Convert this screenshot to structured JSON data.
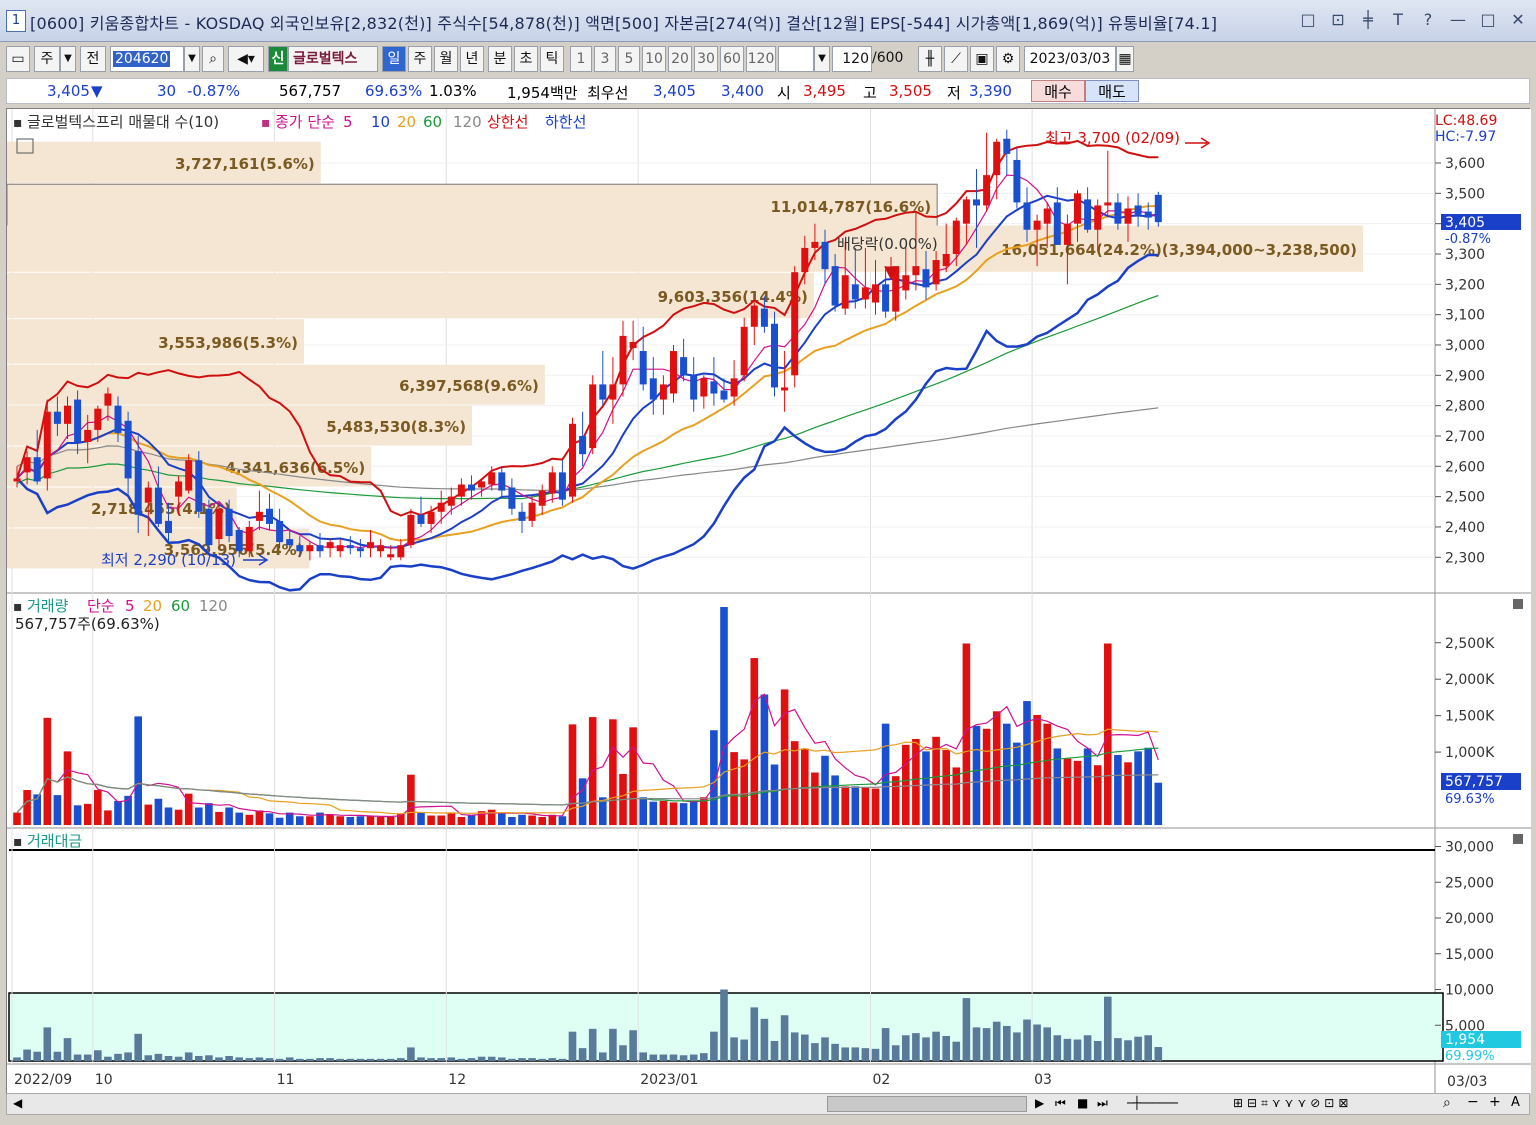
{
  "window": {
    "num": "1",
    "title": "[0600] 키움종합차트 - KOSDAQ 외국인보유[2,832(천)] 주식수[54,878(천)] 액면[500] 자본금[274(억)] 결산[12월] EPS[-544] 시가총액[1,869(억)] 유통비율[74.1]",
    "icons": [
      "□",
      "⊡",
      "╪",
      "T",
      "?",
      "—",
      "□",
      "✕"
    ]
  },
  "toolbar": {
    "type": "주",
    "prev": "전",
    "code": "204620",
    "new_badge": "신",
    "stock_name": "글로벌텍스",
    "periods": [
      "일",
      "주",
      "월",
      "년",
      "분",
      "초",
      "틱"
    ],
    "intervals": [
      "1",
      "3",
      "5",
      "10",
      "20",
      "30",
      "60",
      "120"
    ],
    "count": "120",
    "count_total": "/600",
    "date": "2023/03/03"
  },
  "quote": {
    "price": "3,405",
    "arrow": "▼",
    "change": "30",
    "change_pct": "-0.87%",
    "volume": "567,757",
    "vol_ratio": "69.63%",
    "turnover": "1.03%",
    "amount": "1,954백만",
    "best_label": "최우선",
    "ask": "3,405",
    "bid": "3,400",
    "open_label": "시",
    "open": "3,495",
    "high_label": "고",
    "high": "3,505",
    "low_label": "저",
    "low": "3,390",
    "buy": "매수",
    "sell": "매도"
  },
  "price_legend": {
    "vp_label": "글로벌텍스프리 매물대 수(10)",
    "ma_label": "종가 단순",
    "ma": [
      "5",
      "10",
      "20",
      "60",
      "120"
    ],
    "upper": "상한선",
    "lower": "하한선"
  },
  "price_info": {
    "lc": "LC:48.69",
    "hc": "HC:-7.97",
    "current": "3,405",
    "current_pct": "-0.87%",
    "hi_ann": "최고 3,700 (02/09)",
    "lo_ann": "최저 2,290 (10/13)",
    "div_ann": "배당락(0.00%)"
  },
  "vol_legend": {
    "label": "거래량",
    "ma_label": "단순",
    "ma": [
      "5",
      "20",
      "60",
      "120"
    ],
    "value": "567,757주(69.63%)",
    "current": "567,757",
    "current_pct": "69.63%"
  },
  "amt_legend": {
    "label": "거래대금",
    "current": "1,954",
    "current_pct": "69.99%"
  },
  "price_axis": [
    "3,600",
    "3,500",
    "3,400",
    "3,300",
    "3,200",
    "3,100",
    "3,000",
    "2,900",
    "2,800",
    "2,700",
    "2,600",
    "2,500",
    "2,400",
    "2,300"
  ],
  "vol_axis": [
    "2,500K",
    "2,000K",
    "1,500K",
    "1,000K"
  ],
  "amt_axis": [
    "30,000",
    "25,000",
    "20,000",
    "15,000",
    "10,000",
    "5,000"
  ],
  "x_axis": [
    {
      "label": "2022/09",
      "i": 0
    },
    {
      "label": "10",
      "i": 8
    },
    {
      "label": "11",
      "i": 26
    },
    {
      "label": "12",
      "i": 43
    },
    {
      "label": "2023/01",
      "i": 62
    },
    {
      "label": "02",
      "i": 85
    },
    {
      "label": "03",
      "i": 101
    }
  ],
  "x_axis_right": "03/03",
  "volume_profile": [
    {
      "label": "3,727,161(5.6%)",
      "lo": 3530,
      "hi": 3670,
      "pct": 5.6
    },
    {
      "label": "11,014,787(16.6%)",
      "lo": 3385,
      "hi": 3530,
      "pct": 16.6
    },
    {
      "label": "16,051,664(24.2%)(3,394,000~3,238,500)",
      "lo": 3238,
      "hi": 3394,
      "pct": 24.2
    },
    {
      "label": "9,603,356(14.4%)",
      "lo": 3085,
      "hi": 3238,
      "pct": 14.4
    },
    {
      "label": "3,553,986(5.3%)",
      "lo": 2935,
      "hi": 3085,
      "pct": 5.3
    },
    {
      "label": "6,397,568(9.6%)",
      "lo": 2800,
      "hi": 2935,
      "pct": 9.6
    },
    {
      "label": "5,483,530(8.3%)",
      "lo": 2665,
      "hi": 2800,
      "pct": 8.3
    },
    {
      "label": "4,341,636(6.5%)",
      "lo": 2530,
      "hi": 2665,
      "pct": 6.5
    },
    {
      "label": "2,718,455(4.1%)",
      "lo": 2395,
      "hi": 2530,
      "pct": 4.1
    },
    {
      "label": "3,569,956(5.4%)",
      "lo": 2260,
      "hi": 2395,
      "pct": 5.4
    }
  ],
  "candles": [
    [
      2550,
      2600,
      2530,
      2560
    ],
    [
      2580,
      2650,
      2540,
      2630
    ],
    [
      2630,
      2720,
      2540,
      2550
    ],
    [
      2560,
      2820,
      2520,
      2780
    ],
    [
      2780,
      2830,
      2700,
      2740
    ],
    [
      2740,
      2830,
      2690,
      2800
    ],
    [
      2820,
      2850,
      2640,
      2680
    ],
    [
      2680,
      2770,
      2610,
      2720
    ],
    [
      2720,
      2800,
      2680,
      2790
    ],
    [
      2800,
      2860,
      2750,
      2840
    ],
    [
      2800,
      2830,
      2680,
      2710
    ],
    [
      2750,
      2780,
      2500,
      2560
    ],
    [
      2650,
      2700,
      2380,
      2440
    ],
    [
      2480,
      2550,
      2370,
      2530
    ],
    [
      2530,
      2600,
      2400,
      2410
    ],
    [
      2420,
      2480,
      2350,
      2380
    ],
    [
      2500,
      2570,
      2440,
      2550
    ],
    [
      2520,
      2640,
      2510,
      2620
    ],
    [
      2620,
      2650,
      2430,
      2450
    ],
    [
      2460,
      2490,
      2320,
      2340
    ],
    [
      2360,
      2480,
      2340,
      2460
    ],
    [
      2460,
      2490,
      2350,
      2370
    ],
    [
      2390,
      2400,
      2300,
      2320
    ],
    [
      2320,
      2420,
      2300,
      2400
    ],
    [
      2420,
      2520,
      2390,
      2450
    ],
    [
      2460,
      2510,
      2390,
      2410
    ],
    [
      2420,
      2460,
      2330,
      2350
    ],
    [
      2360,
      2390,
      2320,
      2340
    ],
    [
      2340,
      2370,
      2300,
      2320
    ],
    [
      2320,
      2350,
      2290,
      2340
    ],
    [
      2340,
      2380,
      2300,
      2320
    ],
    [
      2330,
      2360,
      2300,
      2350
    ],
    [
      2320,
      2360,
      2300,
      2340
    ],
    [
      2340,
      2370,
      2310,
      2330
    ],
    [
      2330,
      2360,
      2300,
      2320
    ],
    [
      2330,
      2390,
      2300,
      2350
    ],
    [
      2320,
      2360,
      2300,
      2340
    ],
    [
      2300,
      2340,
      2290,
      2310
    ],
    [
      2300,
      2360,
      2290,
      2340
    ],
    [
      2340,
      2460,
      2330,
      2440
    ],
    [
      2440,
      2500,
      2400,
      2410
    ],
    [
      2410,
      2470,
      2380,
      2450
    ],
    [
      2450,
      2520,
      2410,
      2480
    ],
    [
      2470,
      2530,
      2440,
      2500
    ],
    [
      2500,
      2560,
      2470,
      2540
    ],
    [
      2540,
      2570,
      2490,
      2520
    ],
    [
      2530,
      2560,
      2500,
      2550
    ],
    [
      2540,
      2600,
      2520,
      2580
    ],
    [
      2580,
      2600,
      2500,
      2520
    ],
    [
      2530,
      2560,
      2440,
      2460
    ],
    [
      2450,
      2480,
      2380,
      2420
    ],
    [
      2420,
      2500,
      2400,
      2480
    ],
    [
      2470,
      2540,
      2440,
      2520
    ],
    [
      2510,
      2600,
      2480,
      2580
    ],
    [
      2580,
      2620,
      2470,
      2490
    ],
    [
      2500,
      2760,
      2480,
      2740
    ],
    [
      2700,
      2780,
      2600,
      2640
    ],
    [
      2660,
      2900,
      2640,
      2870
    ],
    [
      2870,
      2980,
      2800,
      2820
    ],
    [
      2820,
      2960,
      2740,
      2870
    ],
    [
      2870,
      3080,
      2830,
      3030
    ],
    [
      2990,
      3080,
      2950,
      3010
    ],
    [
      2980,
      3060,
      2850,
      2870
    ],
    [
      2890,
      2960,
      2770,
      2820
    ],
    [
      2820,
      2900,
      2770,
      2870
    ],
    [
      2840,
      3000,
      2810,
      2980
    ],
    [
      2960,
      3020,
      2880,
      2900
    ],
    [
      2900,
      2960,
      2780,
      2820
    ],
    [
      2830,
      2900,
      2790,
      2890
    ],
    [
      2880,
      2960,
      2800,
      2840
    ],
    [
      2850,
      2890,
      2810,
      2820
    ],
    [
      2830,
      2950,
      2800,
      2890
    ],
    [
      2900,
      3090,
      2880,
      3060
    ],
    [
      3060,
      3140,
      3000,
      3130
    ],
    [
      3120,
      3160,
      3040,
      3060
    ],
    [
      3070,
      3110,
      2830,
      2860
    ],
    [
      2850,
      2980,
      2780,
      2860
    ],
    [
      2900,
      3260,
      2860,
      3240
    ],
    [
      3240,
      3360,
      3200,
      3320
    ],
    [
      3320,
      3400,
      3280,
      3340
    ],
    [
      3340,
      3380,
      3200,
      3250
    ],
    [
      3260,
      3300,
      3110,
      3130
    ],
    [
      3120,
      3340,
      3100,
      3230
    ],
    [
      3200,
      3320,
      3120,
      3150
    ],
    [
      3150,
      3320,
      3120,
      3190
    ],
    [
      3140,
      3280,
      3100,
      3200
    ],
    [
      3200,
      3260,
      3090,
      3110
    ],
    [
      3110,
      3250,
      3080,
      3260
    ],
    [
      3180,
      3320,
      3150,
      3230
    ],
    [
      3230,
      3440,
      3180,
      3260
    ],
    [
      3250,
      3310,
      3150,
      3190
    ],
    [
      3200,
      3310,
      3180,
      3280
    ],
    [
      3260,
      3400,
      3240,
      3300
    ],
    [
      3300,
      3420,
      3260,
      3410
    ],
    [
      3400,
      3490,
      3330,
      3480
    ],
    [
      3480,
      3580,
      3320,
      3460
    ],
    [
      3460,
      3700,
      3440,
      3560
    ],
    [
      3560,
      3680,
      3480,
      3670
    ],
    [
      3680,
      3710,
      3560,
      3630
    ],
    [
      3610,
      3650,
      3450,
      3470
    ],
    [
      3470,
      3520,
      3340,
      3380
    ],
    [
      3380,
      3430,
      3260,
      3410
    ],
    [
      3400,
      3470,
      3320,
      3450
    ],
    [
      3470,
      3520,
      3330,
      3330
    ],
    [
      3330,
      3430,
      3200,
      3400
    ],
    [
      3400,
      3510,
      3340,
      3500
    ],
    [
      3480,
      3520,
      3370,
      3380
    ],
    [
      3380,
      3480,
      3310,
      3460
    ],
    [
      3460,
      3640,
      3420,
      3470
    ],
    [
      3470,
      3500,
      3380,
      3400
    ],
    [
      3400,
      3490,
      3340,
      3450
    ],
    [
      3460,
      3500,
      3390,
      3430
    ],
    [
      3440,
      3470,
      3380,
      3420
    ],
    [
      3495,
      3505,
      3390,
      3405
    ]
  ],
  "volumes": [
    170,
    480,
    420,
    1470,
    410,
    1010,
    270,
    290,
    480,
    200,
    330,
    400,
    1490,
    280,
    360,
    240,
    210,
    430,
    240,
    300,
    180,
    240,
    170,
    140,
    200,
    160,
    100,
    170,
    120,
    120,
    170,
    140,
    120,
    110,
    120,
    130,
    110,
    110,
    160,
    690,
    170,
    130,
    130,
    170,
    110,
    130,
    190,
    210,
    170,
    110,
    140,
    130,
    110,
    140,
    120,
    1380,
    640,
    1480,
    380,
    1450,
    700,
    1340,
    380,
    320,
    330,
    310,
    300,
    330,
    380,
    1300,
    2990,
    1000,
    900,
    2290,
    1790,
    830,
    1860,
    1150,
    1050,
    720,
    950,
    680,
    530,
    530,
    520,
    500,
    1390,
    670,
    1100,
    1180,
    1010,
    1210,
    1030,
    790,
    2490,
    1360,
    1320,
    1560,
    1390,
    1130,
    1700,
    1510,
    1390,
    1050,
    910,
    880,
    1050,
    820,
    2490,
    960,
    860,
    1010,
    1060,
    580
  ],
  "amt_values": [
    500,
    1600,
    1300,
    4700,
    1300,
    3200,
    900,
    900,
    1500,
    600,
    1000,
    1200,
    3800,
    800,
    1000,
    700,
    600,
    1200,
    700,
    800,
    500,
    700,
    500,
    400,
    500,
    400,
    300,
    500,
    300,
    300,
    400,
    400,
    300,
    300,
    300,
    300,
    300,
    300,
    400,
    1900,
    500,
    400,
    400,
    500,
    300,
    400,
    600,
    600,
    500,
    300,
    400,
    400,
    300,
    400,
    300,
    4100,
    1800,
    4500,
    1200,
    4500,
    2200,
    4300,
    1200,
    900,
    900,
    900,
    800,
    900,
    1100,
    4100,
    10000,
    3300,
    3000,
    7500,
    5900,
    2800,
    6400,
    4000,
    3700,
    2500,
    3300,
    2400,
    1900,
    1900,
    1800,
    1700,
    4600,
    2200,
    3600,
    3900,
    3300,
    4100,
    3500,
    2700,
    8800,
    4700,
    4600,
    5500,
    4900,
    4000,
    5800,
    5100,
    4700,
    3600,
    3100,
    3000,
    3600,
    2800,
    9000,
    3200,
    2900,
    3400,
    3600,
    1954
  ]
}
